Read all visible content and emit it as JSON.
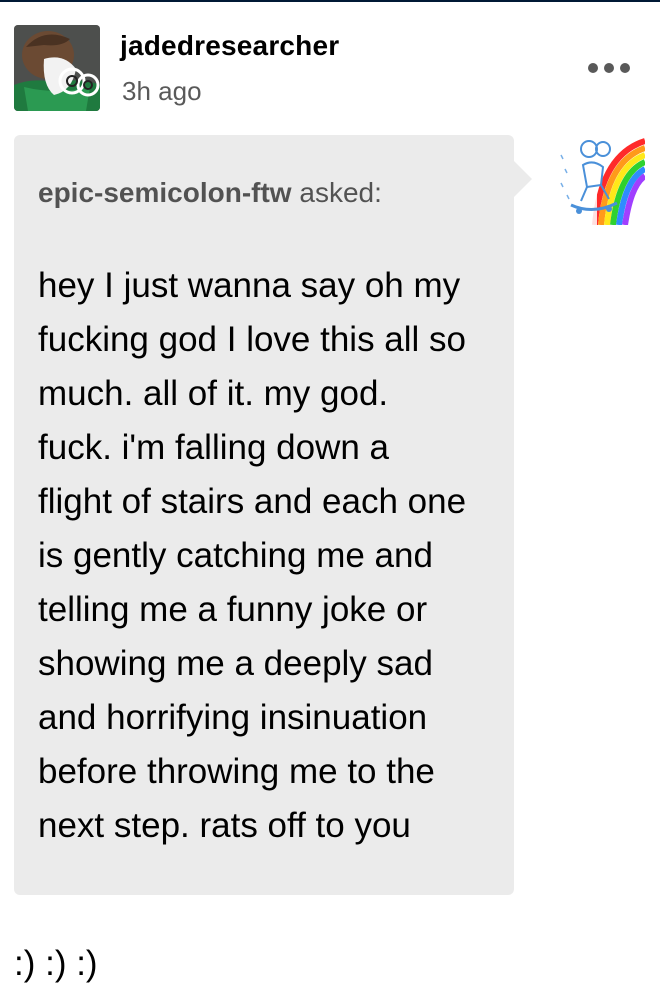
{
  "post": {
    "author": "jadedresearcher",
    "timestamp": "3h ago",
    "more_icon": "ellipsis-icon",
    "author_avatar_icon": "masked-figure-avatar",
    "ask": {
      "asker": "epic-semicolon-ftw",
      "asked_label": "asked:",
      "asker_avatar_icon": "rainbow-skateboarder-avatar",
      "question_lines": [
        "hey I just wanna say oh my",
        "fucking god I love this all so",
        "much. all of it. my god.",
        "fuck. i'm falling down a",
        "flight of stairs and each one",
        "is gently catching me and",
        "telling me a funny joke or",
        "showing me a deeply sad",
        "and horrifying insinuation",
        "before throwing me to the",
        "next step. rats off to you"
      ]
    },
    "reply": ":) :) :)"
  },
  "colors": {
    "bubble_bg": "#ebebeb",
    "top_border": "#001935",
    "secondary_text": "rgba(0,0,0,0.65)"
  }
}
